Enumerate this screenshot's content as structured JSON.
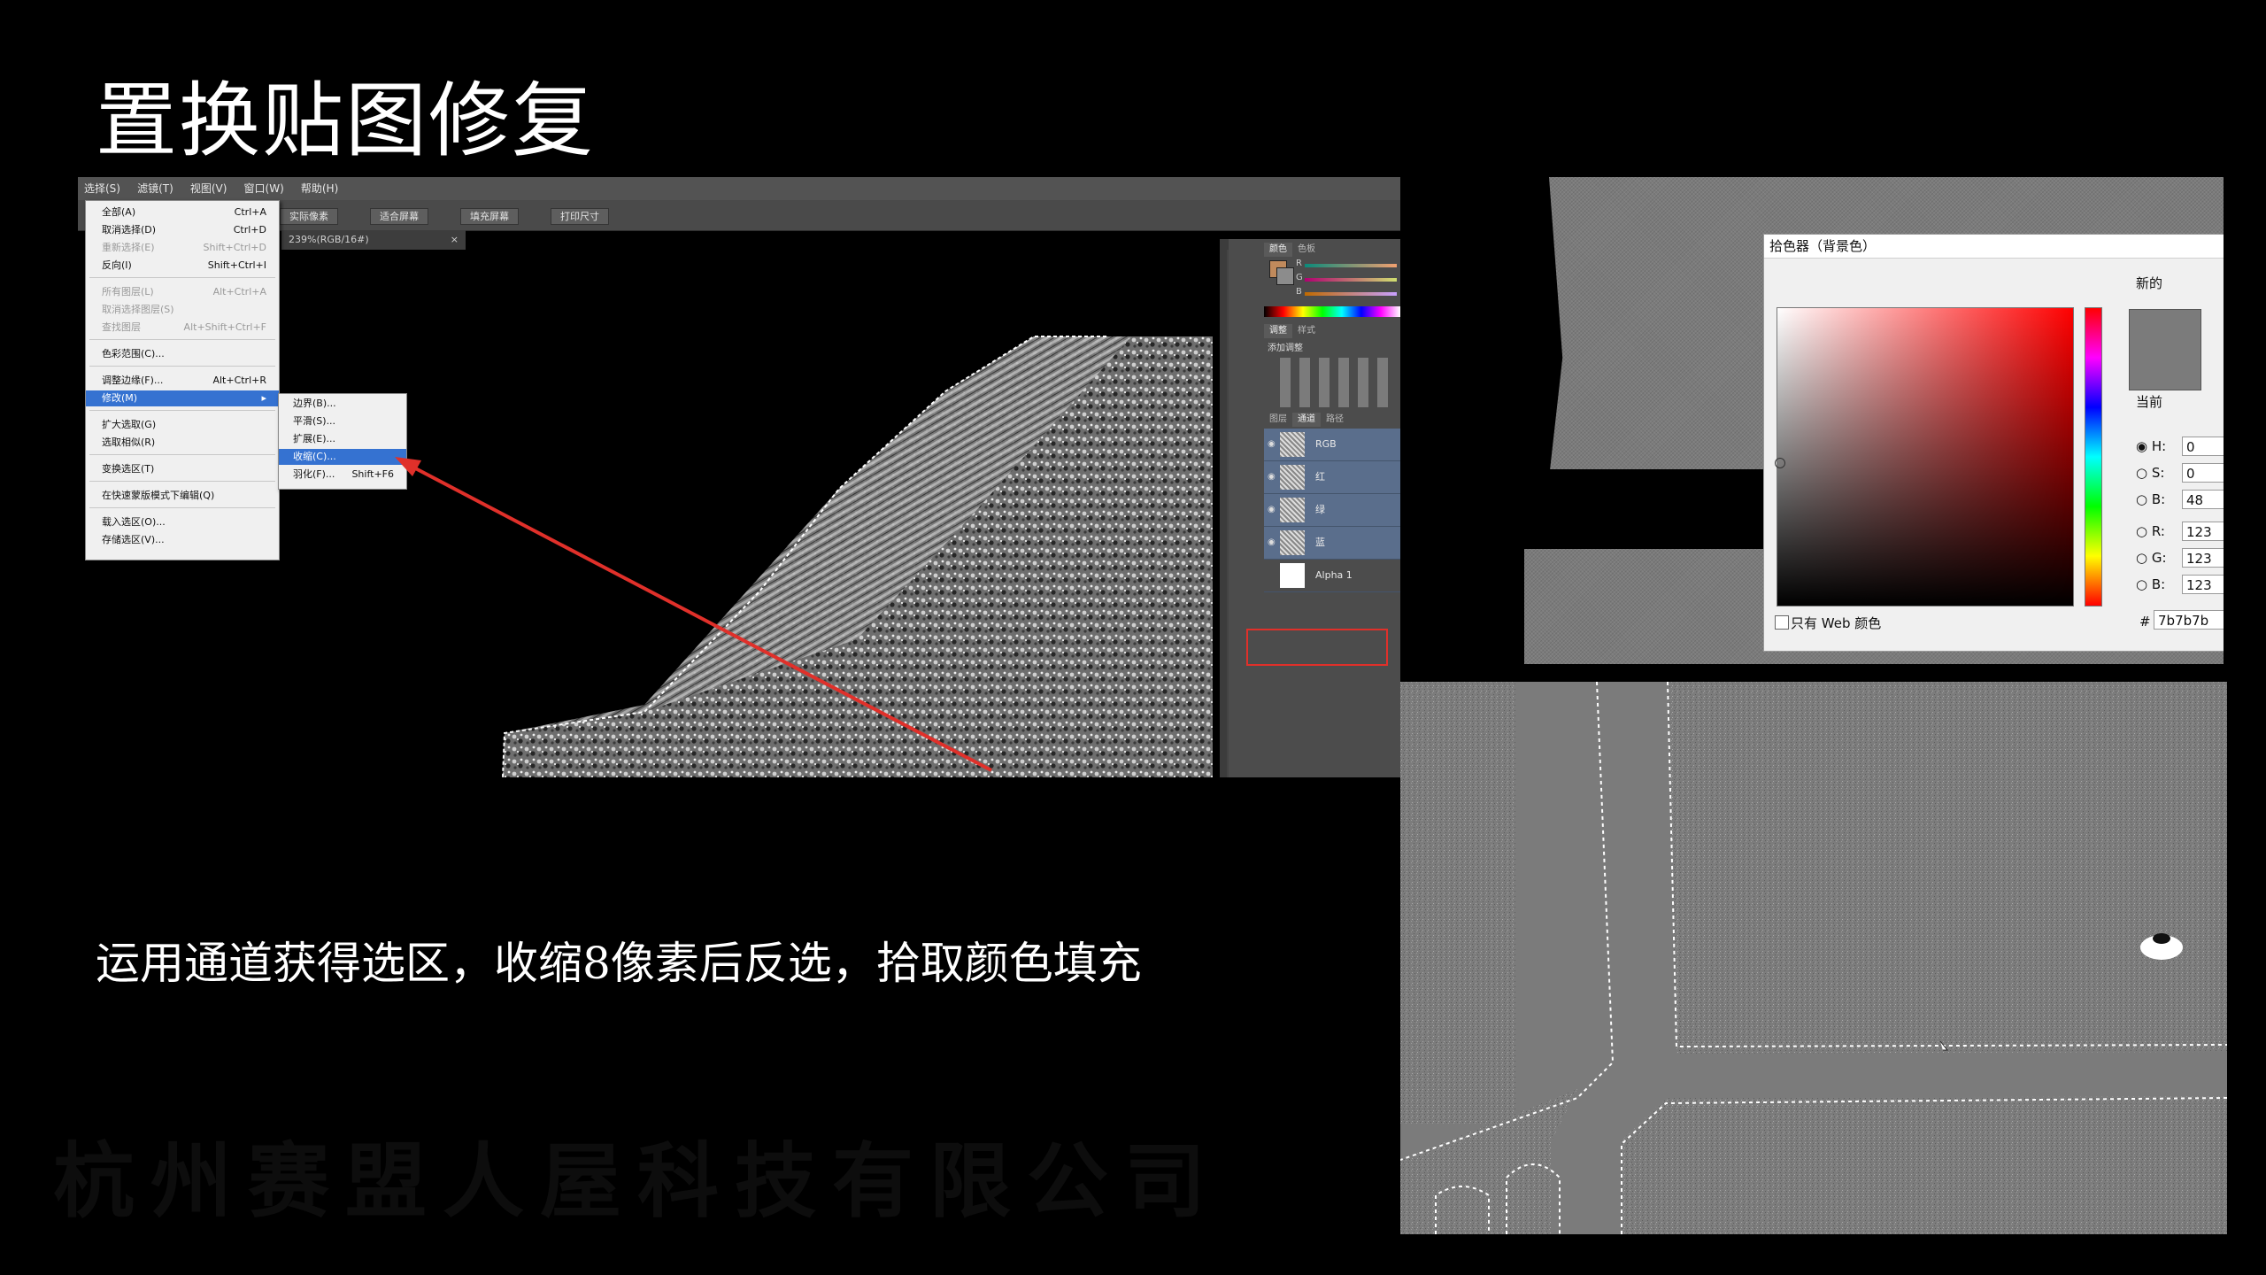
{
  "slide": {
    "title": "置换贴图修复",
    "caption": "运用通道获得选区，收缩8像素后反选，拾取颜色填充",
    "watermark": "杭州赛盟人屋科技有限公司"
  },
  "photoshop": {
    "menubar": [
      "选择(S)",
      "滤镜(T)",
      "视图(V)",
      "窗口(W)",
      "帮助(H)"
    ],
    "option_buttons": [
      "实际像素",
      "适合屏幕",
      "填充屏幕",
      "打印尺寸"
    ],
    "document_tab": "239%(RGB/16#)",
    "select_menu": [
      {
        "label": "全部(A)",
        "shortcut": "Ctrl+A",
        "disabled": false
      },
      {
        "label": "取消选择(D)",
        "shortcut": "Ctrl+D",
        "disabled": false
      },
      {
        "label": "重新选择(E)",
        "shortcut": "Shift+Ctrl+D",
        "disabled": true
      },
      {
        "label": "反向(I)",
        "shortcut": "Shift+Ctrl+I",
        "disabled": false
      },
      {
        "label": "所有图层(L)",
        "shortcut": "Alt+Ctrl+A",
        "disabled": true
      },
      {
        "label": "取消选择图层(S)",
        "shortcut": "",
        "disabled": true
      },
      {
        "label": "查找图层",
        "shortcut": "Alt+Shift+Ctrl+F",
        "disabled": true
      },
      {
        "label": "色彩范围(C)...",
        "shortcut": "",
        "disabled": false
      },
      {
        "label": "调整边缘(F)...",
        "shortcut": "Alt+Ctrl+R",
        "disabled": false
      },
      {
        "label": "修改(M)",
        "shortcut": "▸",
        "disabled": false,
        "highlighted": true
      },
      {
        "label": "扩大选取(G)",
        "shortcut": "",
        "disabled": false
      },
      {
        "label": "选取相似(R)",
        "shortcut": "",
        "disabled": false
      },
      {
        "label": "变换选区(T)",
        "shortcut": "",
        "disabled": false
      },
      {
        "label": "在快速蒙版模式下编辑(Q)",
        "shortcut": "",
        "disabled": false
      },
      {
        "label": "载入选区(O)...",
        "shortcut": "",
        "disabled": false
      },
      {
        "label": "存储选区(V)...",
        "shortcut": "",
        "disabled": false
      }
    ],
    "modify_submenu": [
      {
        "label": "边界(B)...",
        "shortcut": ""
      },
      {
        "label": "平滑(S)...",
        "shortcut": ""
      },
      {
        "label": "扩展(E)...",
        "shortcut": ""
      },
      {
        "label": "收缩(C)...",
        "shortcut": "",
        "highlighted": true
      },
      {
        "label": "羽化(F)...",
        "shortcut": "Shift+F6"
      }
    ],
    "color_panel_tabs": [
      "颜色",
      "色板"
    ],
    "color_channels": [
      "R",
      "G",
      "B"
    ],
    "adjust_panel_tabs": [
      "调整",
      "样式"
    ],
    "adjust_panel_label": "添加调整",
    "layer_panel_tabs": [
      "图层",
      "通道",
      "路径"
    ],
    "channels": [
      {
        "name": "RGB"
      },
      {
        "name": "红"
      },
      {
        "name": "绿"
      },
      {
        "name": "蓝"
      },
      {
        "name": "Alpha 1"
      }
    ]
  },
  "color_picker": {
    "title": "拾色器（背景色）",
    "new_label": "新的",
    "current_label": "当前",
    "web_only_label": "只有 Web 颜色",
    "swatch_color": "#7b7b7b",
    "fields": [
      {
        "label": "H:",
        "value": "0",
        "selected": true
      },
      {
        "label": "S:",
        "value": "0",
        "selected": false
      },
      {
        "label": "B:",
        "value": "48",
        "selected": false
      },
      {
        "label": "R:",
        "value": "123",
        "selected": false
      },
      {
        "label": "G:",
        "value": "123",
        "selected": false
      },
      {
        "label": "B:",
        "value": "123",
        "selected": false
      }
    ],
    "hex_label": "#",
    "hex_value": "7b7b7b"
  },
  "colors": {
    "highlight": "#3572d1",
    "annotation_red": "#e0302a",
    "fill_gray": "#7b7b7b"
  }
}
